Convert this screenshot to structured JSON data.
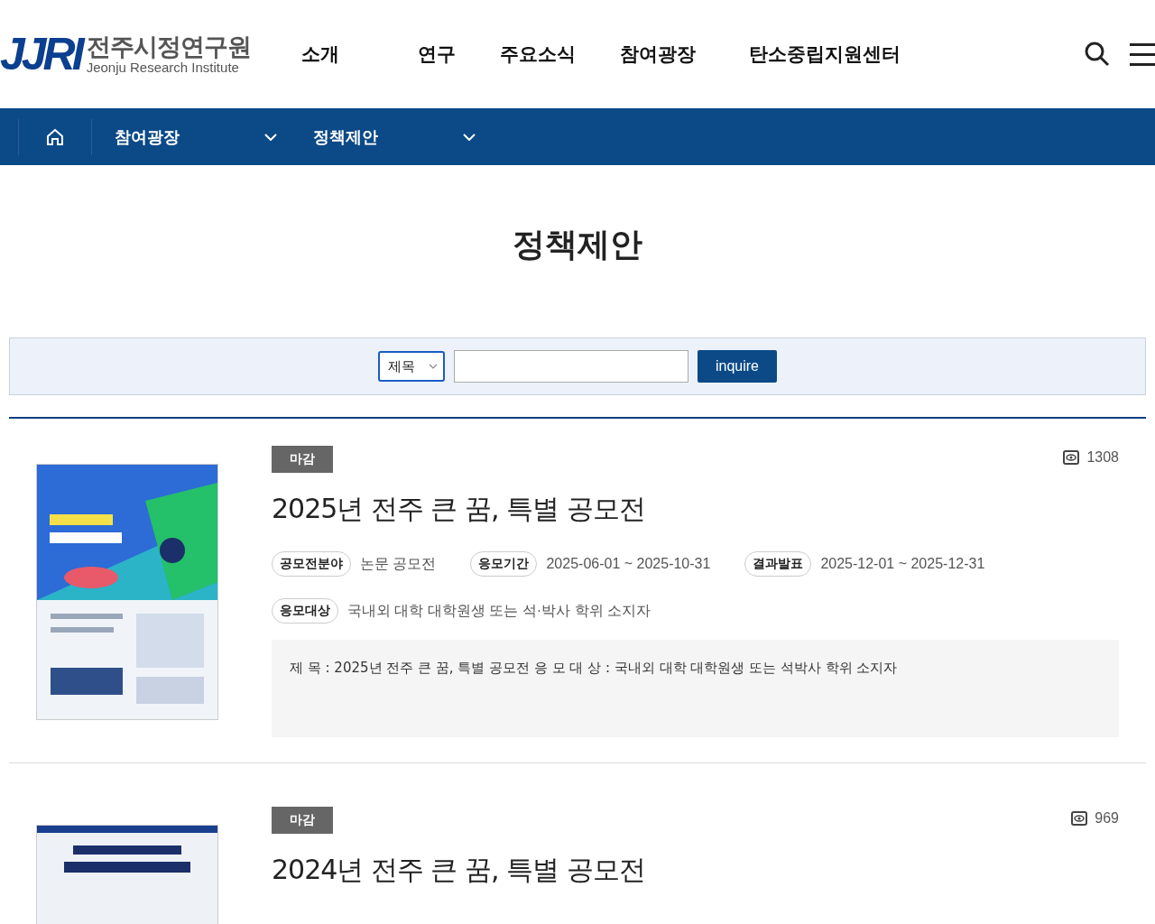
{
  "header": {
    "logo": {
      "mark": "JJRI",
      "name": "전주시정연구원",
      "subtitle": "Jeonju Research Institute"
    },
    "menu": [
      "소개",
      "연구",
      "주요소식",
      "참여광장",
      "탄소중립지원센터"
    ]
  },
  "breadcrumb": [
    "참여광장",
    "정책제안"
  ],
  "page_title": "정책제안",
  "search": {
    "field_select": "제목",
    "button": "inquire"
  },
  "posts": [
    {
      "status": "마감",
      "views": "1308",
      "title": "2025년 전주 큰 꿈, 특별 공모전",
      "poster": {
        "kind": "picture"
      },
      "fields": [
        {
          "label": "공모전분야",
          "value": "논문 공모전"
        },
        {
          "label": "응모기간",
          "value": "2025-06-01 ~ 2025-10-31"
        },
        {
          "label": "결과발표",
          "value": "2025-12-01 ~ 2025-12-31"
        },
        {
          "label": "응모대상",
          "value": "국내외 대학 대학원생 또는 석·박사 학위 소지자"
        }
      ],
      "summary": "제 목 : 2025년 전주 큰 꿈, 특별 공모전 응 모 대 상 : 국내외 대학 대학원생 또는 석박사 학위 소지자"
    },
    {
      "status": "마감",
      "views": "969",
      "title": "2024년 전주 큰 꿈, 특별 공모전",
      "poster": {
        "kind": "picture"
      }
    }
  ]
}
